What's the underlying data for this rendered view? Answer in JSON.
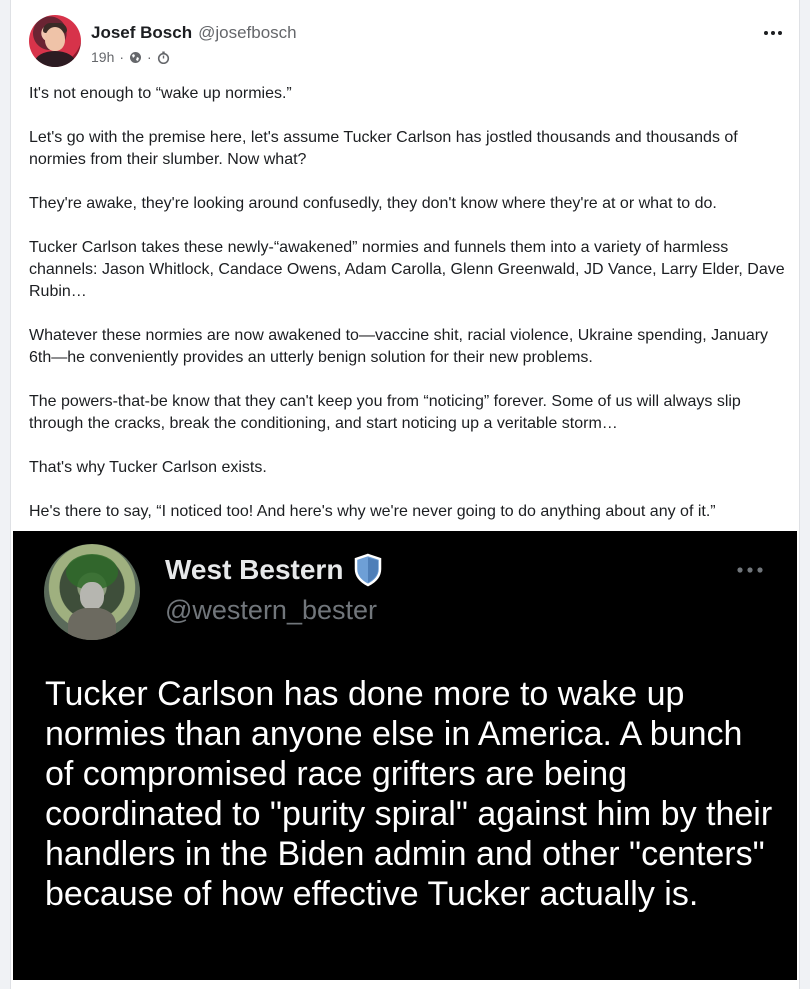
{
  "post": {
    "author_name": "Josef Bosch",
    "author_handle": "@josefbosch",
    "time": "19h",
    "separator": "·",
    "paragraphs": [
      "It's not enough to “wake up normies.”",
      "Let's go with the premise here, let's assume Tucker Carlson has jostled thousands and thousands of normies from their slumber. Now what?",
      "They're awake, they're looking around confusedly, they don't know where they're at or what to do.",
      "Tucker Carlson takes these newly-“awakened” normies and funnels them into a variety of harmless channels: Jason Whitlock, Candace Owens, Adam Carolla, Glenn Greenwald, JD Vance, Larry Elder, Dave Rubin…",
      "Whatever these normies are now awakened to—vaccine shit, racial violence, Ukraine spending, January 6th—he conveniently provides an utterly benign solution for their new problems.",
      "The powers-that-be know that they can't keep you from “noticing” forever. Some of us will always slip through the cracks, break the conditioning, and start noticing up a veritable storm…",
      "That's why Tucker Carlson exists.",
      "He's there to say, “I noticed too! And here's why we're never going to do anything about any of it.”"
    ],
    "icons": {
      "visibility": "globe-icon",
      "timer": "timer-icon",
      "more": "more-options-icon"
    }
  },
  "embedded_tweet": {
    "author_name": "West Bestern",
    "author_handle": "@western_bester",
    "text": "Tucker Carlson has done more to wake up normies than anyone else in America. A bunch of compromised race grifters are being coordinated to \"purity spiral\" against him by their handlers in the Biden admin and other \"centers\" because of how effective Tucker actually is.",
    "badge_color": "#6e9fd6",
    "icons": {
      "badge": "shield-icon",
      "more": "more-options-icon"
    }
  },
  "colors": {
    "page_bg": "#f0f2f5",
    "card_bg": "#ffffff",
    "text_primary": "#1c1e21",
    "text_secondary": "#65676b",
    "tweet_bg": "#000000",
    "tweet_text": "#ffffff",
    "tweet_secondary": "#71767b"
  }
}
